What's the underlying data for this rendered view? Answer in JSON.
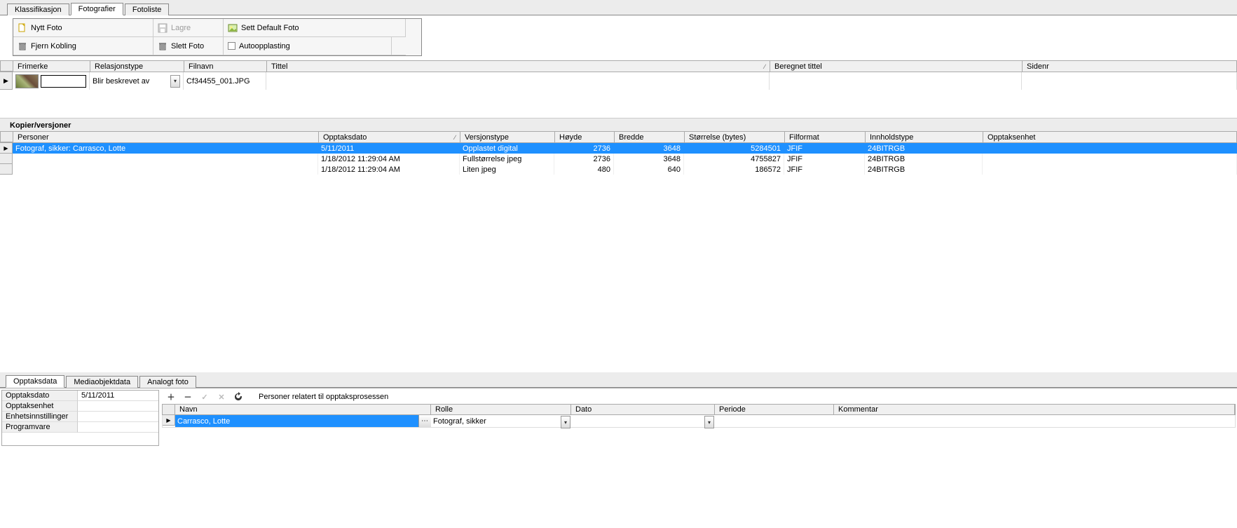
{
  "top_tabs": {
    "klass": "Klassifikasjon",
    "foto": "Fotografier",
    "liste": "Fotoliste"
  },
  "toolbar": {
    "nytt": "Nytt Foto",
    "lagre": "Lagre",
    "sett_default": "Sett Default Foto",
    "fjern": "Fjern Kobling",
    "slett": "Slett Foto",
    "auto": "Autoopplasting"
  },
  "grid1": {
    "headers": {
      "frimerke": "Frimerke",
      "relasjon": "Relasjonstype",
      "filnavn": "Filnavn",
      "tittel": "Tittel",
      "beregnet": "Beregnet tittel",
      "sidenr": "Sidenr"
    },
    "row": {
      "relasjon": "Blir beskrevet av",
      "filnavn": "Cf34455_001.JPG"
    }
  },
  "section": "Kopier/versjoner",
  "ver": {
    "headers": {
      "personer": "Personer",
      "opptaksdato": "Opptaksdato",
      "versjonstype": "Versjonstype",
      "hoyde": "Høyde",
      "bredde": "Bredde",
      "storrelse": "Størrelse (bytes)",
      "filformat": "Filformat",
      "innhold": "Innholdstype",
      "enhet": "Opptaksenhet"
    },
    "rows": [
      {
        "personer": "Fotograf, sikker: Carrasco, Lotte",
        "dato": "5/11/2011",
        "type": "Opplastet digital",
        "h": "2736",
        "b": "3648",
        "s": "5284501",
        "ff": "JFIF",
        "inn": "24BITRGB",
        "enh": ""
      },
      {
        "personer": "",
        "dato": "1/18/2012 11:29:04 AM",
        "type": "Fullstørrelse jpeg",
        "h": "2736",
        "b": "3648",
        "s": "4755827",
        "ff": "JFIF",
        "inn": "24BITRGB",
        "enh": ""
      },
      {
        "personer": "",
        "dato": "1/18/2012 11:29:04 AM",
        "type": "Liten jpeg",
        "h": "480",
        "b": "640",
        "s": "186572",
        "ff": "JFIF",
        "inn": "24BITRGB",
        "enh": ""
      }
    ]
  },
  "bottom_tabs": {
    "opptak": "Opptaksdata",
    "media": "Mediaobjektdata",
    "analogt": "Analogt foto"
  },
  "props": {
    "opptaksdato_k": "Opptaksdato",
    "opptaksdato_v": "5/11/2011",
    "opptaksenhet_k": "Opptaksenhet",
    "opptaksenhet_v": "",
    "enhet_k": "Enhetsinnstillinger",
    "enhet_v": "",
    "prog_k": "Programvare",
    "prog_v": ""
  },
  "mini_title": "Personer relatert til opptaksprosessen",
  "person_headers": {
    "navn": "Navn",
    "rolle": "Rolle",
    "dato": "Dato",
    "periode": "Periode",
    "kommentar": "Kommentar"
  },
  "person_row": {
    "navn": "Carrasco, Lotte",
    "rolle": "Fotograf, sikker",
    "dato": "",
    "periode": "",
    "kommentar": ""
  }
}
